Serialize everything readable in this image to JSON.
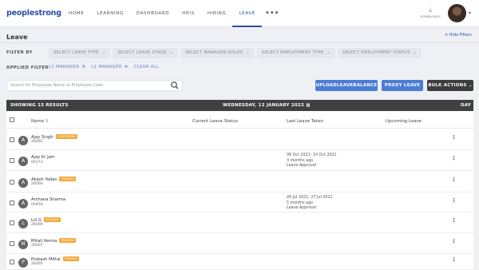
{
  "brand": {
    "logo": "peoplestrong"
  },
  "nav": {
    "items": [
      {
        "id": "home",
        "label": "HOME"
      },
      {
        "id": "learning",
        "label": "LEARNING"
      },
      {
        "id": "dashboard",
        "label": "DASHBOARD"
      },
      {
        "id": "hris",
        "label": "HRIS"
      },
      {
        "id": "hiring",
        "label": "HIRING"
      },
      {
        "id": "leave",
        "label": "LEAVE",
        "active": true
      }
    ],
    "more": "•••",
    "download_label": "DOWNLOADS",
    "download_icon": "download-icon"
  },
  "page": {
    "title": "Leave",
    "hide_filters": "✕ Hide Filters"
  },
  "filters": {
    "label": "FILTER BY",
    "dropdowns": [
      "SELECT LEAVE TYPE",
      "SELECT LEAVE STAGE",
      "SELECT MANAGER ROLES",
      "SELECT EMPLOYMENT TYPE",
      "SELECT EMPLOYMENT STATUS"
    ],
    "applied_label": "APPLIED FILTER",
    "applied": [
      "L1 MANAGER",
      "L1 MANAGER"
    ],
    "clear_all": "CLEAR ALL"
  },
  "search": {
    "placeholder": "Search for Employee Name or Employee Code",
    "icon": "search-icon"
  },
  "actions": {
    "upload": "UPLOADLEAVEBALANCE",
    "proxy": "PROXY LEAVE",
    "bulk": "BULK ACTIONS ⌄"
  },
  "results": {
    "label": "SHOWING 15 RESULTS",
    "date": "WEDNESDAY, 12 JANUARY 2022",
    "view": "DAY"
  },
  "table": {
    "columns": {
      "name": "Name",
      "current": "Current Leave Status",
      "last": "Last Leave Taken",
      "upcoming": "Upcoming Leave"
    },
    "rows": [
      {
        "initial": "A",
        "name": "Ajay Singh",
        "id": "26002",
        "badge": "CONFIRMED",
        "last": []
      },
      {
        "initial": "A",
        "name": "Ajay Kr Jain",
        "id": "00173",
        "badge": "",
        "last": [
          "08 Oct 2021- 10 Oct 2021",
          "3 months ago",
          "Leave Approval"
        ]
      },
      {
        "initial": "A",
        "name": "Akash Yadav",
        "id": "26004",
        "badge": "TRAINEE",
        "last": []
      },
      {
        "initial": "A",
        "name": "Archana Sharma",
        "id": "00450",
        "badge": "",
        "last": [
          "26 Jul 2021- 27 Jul 2021",
          "5 months ago",
          "Leave Approval"
        ]
      },
      {
        "initial": "L",
        "name": "Lili G",
        "id": "26006",
        "badge": "TRAINEE",
        "last": []
      },
      {
        "initial": "M",
        "name": "Mitali Verma",
        "id": "26007",
        "badge": "TRAINEE",
        "last": []
      },
      {
        "initial": "P",
        "name": "Prakash Mittal",
        "id": "26005",
        "badge": "TRAINEE",
        "last": []
      }
    ]
  }
}
